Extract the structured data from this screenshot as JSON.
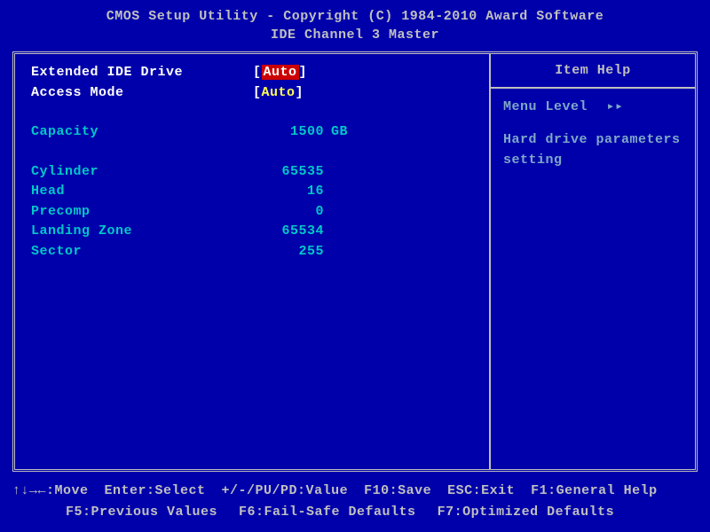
{
  "header": {
    "title": "CMOS Setup Utility - Copyright (C) 1984-2010 Award Software",
    "subtitle": "IDE Channel 3 Master"
  },
  "settings": {
    "ext_ide_label": "Extended IDE Drive",
    "ext_ide_value": "Auto",
    "access_mode_label": "Access Mode",
    "access_mode_value": "Auto",
    "capacity_label": "Capacity",
    "capacity_value": "1500",
    "capacity_unit": "GB",
    "cylinder_label": "Cylinder",
    "cylinder_value": "65535",
    "head_label": "Head",
    "head_value": "16",
    "precomp_label": "Precomp",
    "precomp_value": "0",
    "landing_label": "Landing Zone",
    "landing_value": "65534",
    "sector_label": "Sector",
    "sector_value": "255"
  },
  "help": {
    "title": "Item Help",
    "menu_level_label": "Menu Level",
    "menu_level_indicator": "▸▸",
    "text": "Hard drive parameters setting"
  },
  "footer": {
    "move": "↑↓→←:Move",
    "enter": "Enter:Select",
    "value": "+/-/PU/PD:Value",
    "save": "F10:Save",
    "exit": "ESC:Exit",
    "general_help": "F1:General Help",
    "previous": "F5:Previous Values",
    "failsafe": "F6:Fail-Safe Defaults",
    "optimized": "F7:Optimized Defaults"
  }
}
